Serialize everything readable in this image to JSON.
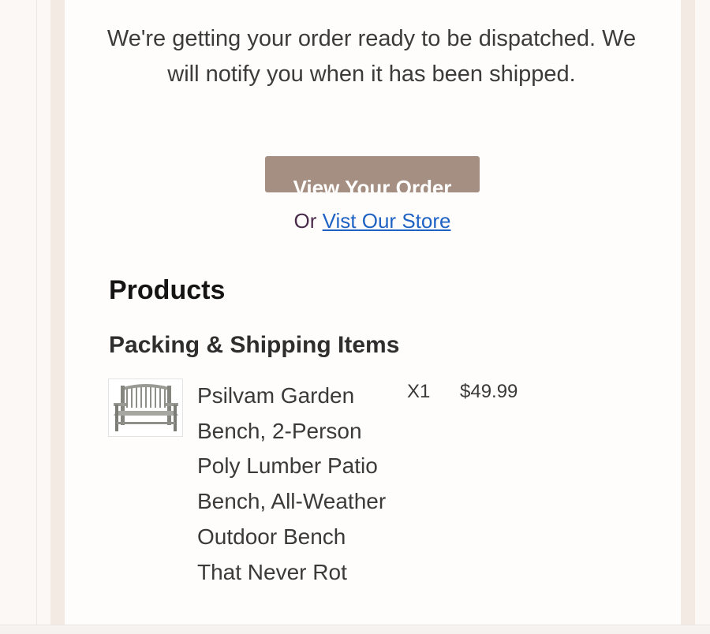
{
  "message": "We're getting your order ready to be dispatched. We will notify you when it has been shipped.",
  "primary_button": {
    "label": "View Your Order"
  },
  "store_link": {
    "prefix": "Or",
    "label": "Vist Our Store"
  },
  "products": {
    "title": "Products",
    "section_title": "Packing & Shipping Items",
    "items": [
      {
        "name": "Psilvam Garden Bench, 2-Person Poly Lumber Patio Bench, All-Weather Outdoor Bench That Never Rot",
        "quantity": "X1",
        "price": "$49.99",
        "image_icon": "garden-bench-image"
      }
    ]
  },
  "colors": {
    "page_background": "#fcf8f6",
    "frame": "#f3ebe3",
    "card": "#fffdfc",
    "button": "#a58f82",
    "link": "#1e63c4",
    "heading": "#141414",
    "text": "#3a3a3a"
  }
}
